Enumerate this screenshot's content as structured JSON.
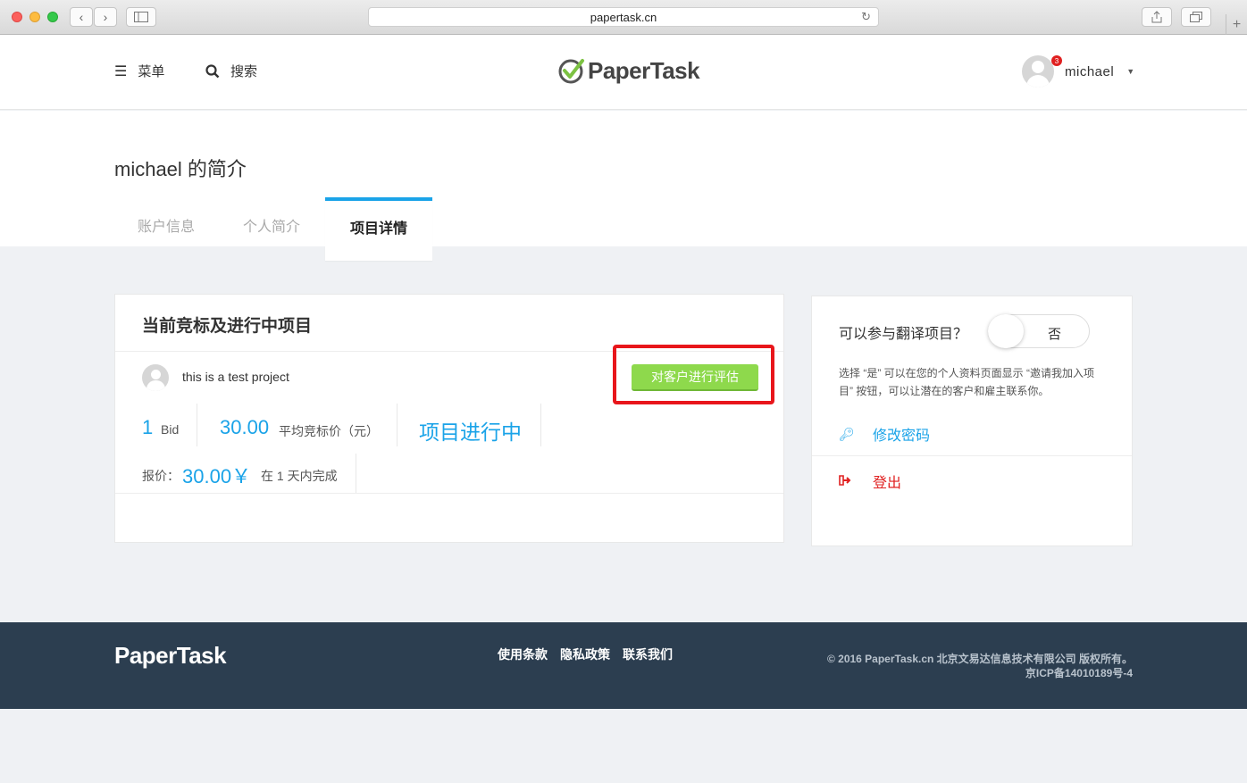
{
  "browser": {
    "url": "papertask.cn"
  },
  "header": {
    "menu_label": "菜单",
    "search_label": "搜索",
    "logo_text": "PaperTask",
    "username": "michael",
    "notification_count": "3"
  },
  "profile": {
    "title": "michael 的简介",
    "tabs": [
      "账户信息",
      "个人简介",
      "项目详情"
    ],
    "active_tab": "项目详情"
  },
  "main_card": {
    "title": "当前竞标及进行中项目",
    "project_name": "this is a test project",
    "evaluate_button": "对客户进行评估",
    "bid_count": "1",
    "bid_label": "Bid",
    "avg_bid": "30.00",
    "avg_bid_label": "平均竞标价（元）",
    "status": "项目进行中",
    "quote_label": "报价：",
    "quote_value": "30.00￥",
    "duration": "在 1 天内完成"
  },
  "side_card": {
    "question": "可以参与翻译项目？",
    "toggle_value": "否",
    "description": "选择 “是” 可以在您的个人资料页面显示 “邀请我加入项目” 按钮，可以让潜在的客户和雇主联系你。",
    "change_password": "修改密码",
    "logout": "登出"
  },
  "footer": {
    "logo_text": "PaperTask",
    "links": [
      "使用条款",
      "隐私政策",
      "联系我们"
    ],
    "copyright": "© 2016 PaperTask.cn 北京文易达信息技术有限公司 版权所有。",
    "icp": "京ICP备14010189号-4"
  },
  "colors": {
    "accent": "#1aa3e8",
    "button_green": "#8ed94c",
    "highlight_red": "#e8161b",
    "footer_bg": "#2c3e50",
    "logout_red": "#e02020"
  }
}
